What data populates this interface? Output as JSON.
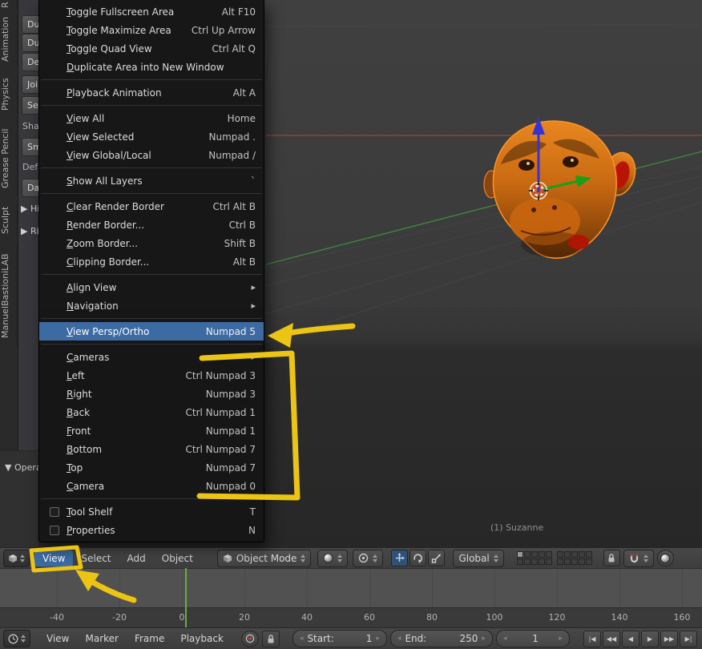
{
  "window": {
    "app": "Blender",
    "editor": "3D View"
  },
  "colors": {
    "menu_highlight": "#3c6ba3",
    "annotation_yellow": "#ecc414",
    "playhead_green": "#61b33e",
    "selection_orange": "#ff9328",
    "axis_red": "#9c4343",
    "axis_green": "#3f8f3f"
  },
  "left_tabs": {
    "items": [
      "R",
      "Animation",
      "Physics",
      "Grease Pencil",
      "Sculpt",
      "ManuelBastioniLAB"
    ]
  },
  "tool_shelf": {
    "fragments": [
      {
        "label": "Dupli",
        "type": "button"
      },
      {
        "label": "Duplica",
        "type": "button"
      },
      {
        "label": "Delet",
        "type": "button"
      },
      {
        "label": "Join",
        "type": "button"
      },
      {
        "label": "Set Origin",
        "type": "button"
      },
      {
        "label": "Shading:",
        "type": "label"
      },
      {
        "label": "Smoot",
        "type": "button"
      },
      {
        "label": "Defau",
        "type": "label"
      },
      {
        "label": "Data",
        "type": "button"
      },
      {
        "label": "Histo",
        "type": "panel"
      },
      {
        "label": "Rig",
        "type": "panel"
      }
    ],
    "operator_panel": "▼ Operat"
  },
  "menu": {
    "items": [
      {
        "label": "Toggle Fullscreen Area",
        "shortcut": "Alt F10"
      },
      {
        "label": "Toggle Maximize Area",
        "shortcut": "Ctrl Up Arrow"
      },
      {
        "label": "Toggle Quad View",
        "shortcut": "Ctrl Alt Q"
      },
      {
        "label": "Duplicate Area into New Window",
        "shortcut": ""
      },
      {
        "separator": true
      },
      {
        "label": "Playback Animation",
        "shortcut": "Alt A"
      },
      {
        "separator": true
      },
      {
        "label": "View All",
        "shortcut": "Home"
      },
      {
        "label": "View Selected",
        "shortcut": "Numpad ."
      },
      {
        "label": "View Global/Local",
        "shortcut": "Numpad /"
      },
      {
        "separator": true
      },
      {
        "label": "Show All Layers",
        "shortcut": "`"
      },
      {
        "separator": true
      },
      {
        "label": "Clear Render Border",
        "shortcut": "Ctrl Alt B"
      },
      {
        "label": "Render Border...",
        "shortcut": "Ctrl B"
      },
      {
        "label": "Zoom Border...",
        "shortcut": "Shift B"
      },
      {
        "label": "Clipping Border...",
        "shortcut": "Alt B"
      },
      {
        "separator": true
      },
      {
        "label": "Align View",
        "submenu": true
      },
      {
        "label": "Navigation",
        "submenu": true
      },
      {
        "separator": true
      },
      {
        "label": "View Persp/Ortho",
        "shortcut": "Numpad 5",
        "highlighted": true
      },
      {
        "separator": true
      },
      {
        "label": "Cameras",
        "submenu": true
      },
      {
        "label": "Left",
        "shortcut": "Ctrl Numpad 3"
      },
      {
        "label": "Right",
        "shortcut": "Numpad 3"
      },
      {
        "label": "Back",
        "shortcut": "Ctrl Numpad 1"
      },
      {
        "label": "Front",
        "shortcut": "Numpad 1"
      },
      {
        "label": "Bottom",
        "shortcut": "Ctrl Numpad 7"
      },
      {
        "label": "Top",
        "shortcut": "Numpad 7"
      },
      {
        "label": "Camera",
        "shortcut": "Numpad 0"
      },
      {
        "separator": true
      },
      {
        "label": "Tool Shelf",
        "shortcut": "T",
        "checkbox": true
      },
      {
        "label": "Properties",
        "shortcut": "N",
        "checkbox": true
      }
    ]
  },
  "viewport": {
    "info_text": "(1) Suzanne",
    "object": "Suzanne monkey head, selected, orange material"
  },
  "header3d": {
    "menus": [
      "View",
      "Select",
      "Add",
      "Object"
    ],
    "active_menu": "View",
    "mode": "Object Mode",
    "orientation": "Global"
  },
  "timeline": {
    "ruler_frames": [
      -40,
      -20,
      0,
      20,
      40,
      60,
      80,
      100,
      120,
      140,
      160
    ],
    "playhead_frame": 1
  },
  "timeline_header": {
    "menus": [
      "View",
      "Marker",
      "Frame",
      "Playback"
    ],
    "start_label": "Start:",
    "start_value": "1",
    "end_label": "End:",
    "end_value": "250",
    "current_frame": "1",
    "playback_buttons": [
      "|◀",
      "◀◀",
      "◀",
      "▶",
      "▶▶",
      "▶|"
    ]
  },
  "annotations": {
    "color": "#ecc414",
    "notes": [
      "arrow-to-view-persp-ortho",
      "box-around-view-axis-items",
      "box-around-view-menu-button",
      "arrow-to-view-menu-button"
    ]
  }
}
